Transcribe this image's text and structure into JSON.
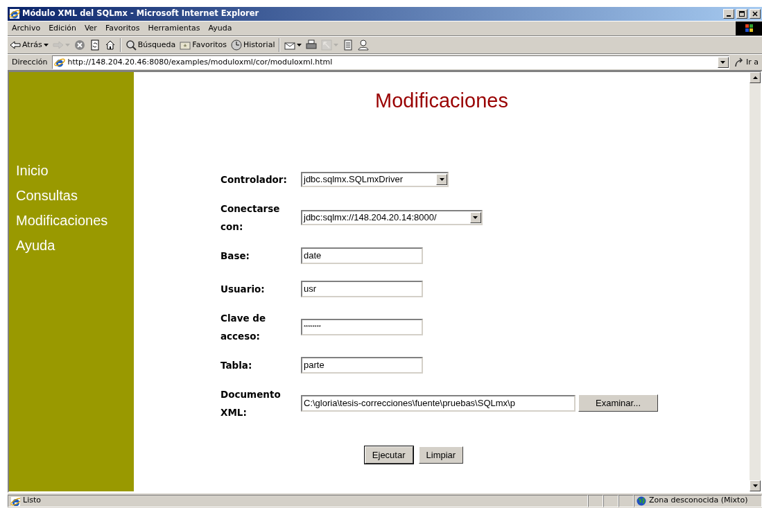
{
  "window": {
    "title": "Módulo XML del SQLmx - Microsoft Internet Explorer"
  },
  "menu": [
    "Archivo",
    "Edición",
    "Ver",
    "Favoritos",
    "Herramientas",
    "Ayuda"
  ],
  "toolbar": [
    {
      "kind": "back",
      "label": "Atrás",
      "dropdown": true,
      "disabled": false
    },
    {
      "kind": "forward",
      "dropdown": true,
      "disabled": true
    },
    {
      "kind": "stop",
      "disabled": false
    },
    {
      "kind": "refresh",
      "disabled": false
    },
    {
      "kind": "home",
      "disabled": false
    },
    {
      "kind": "separator"
    },
    {
      "kind": "search",
      "label": "Búsqueda",
      "disabled": false
    },
    {
      "kind": "favorites",
      "label": "Favoritos",
      "disabled": false
    },
    {
      "kind": "history",
      "label": "Historial",
      "disabled": false
    },
    {
      "kind": "separator"
    },
    {
      "kind": "mail",
      "dropdown": true,
      "disabled": false
    },
    {
      "kind": "print",
      "disabled": false
    },
    {
      "kind": "edit",
      "dropdown": true,
      "disabled": true
    },
    {
      "kind": "discuss",
      "disabled": false
    },
    {
      "kind": "messenger",
      "disabled": false
    }
  ],
  "address": {
    "label": "Dirección",
    "url": "http://148.204.20.46:8080/examples/moduloxml/cor/moduloxml.html",
    "go": "Ir a"
  },
  "sidebar": {
    "items": [
      "Inicio",
      "Consultas",
      "Modificaciones",
      "Ayuda"
    ]
  },
  "page": {
    "heading": "Modificaciones",
    "fields": [
      {
        "label": "Controlador:",
        "kind": "select",
        "value": "jdbc.sqlmx.SQLmxDriver"
      },
      {
        "label": "Conectarse con:",
        "kind": "select",
        "value": "jdbc:sqlmx://148.204.20.14:8000/"
      },
      {
        "label": "Base:",
        "kind": "text",
        "value": "date"
      },
      {
        "label": "Usuario:",
        "kind": "text",
        "value": "usr"
      },
      {
        "label": "Clave de acceso:",
        "kind": "password",
        "value": "********"
      },
      {
        "label": "Tabla:",
        "kind": "text",
        "value": "parte"
      },
      {
        "label": "Documento XML:",
        "kind": "file",
        "value": "C:\\gloria\\tesis-correcciones\\fuente\\pruebas\\SQLmx\\p",
        "button": "Examinar..."
      }
    ],
    "buttons": [
      {
        "label": "Ejecutar",
        "default": true
      },
      {
        "label": "Limpiar",
        "default": false
      }
    ]
  },
  "status_bar": {
    "text": "Listo",
    "zone": "Zona desconocida (Mixto)"
  }
}
